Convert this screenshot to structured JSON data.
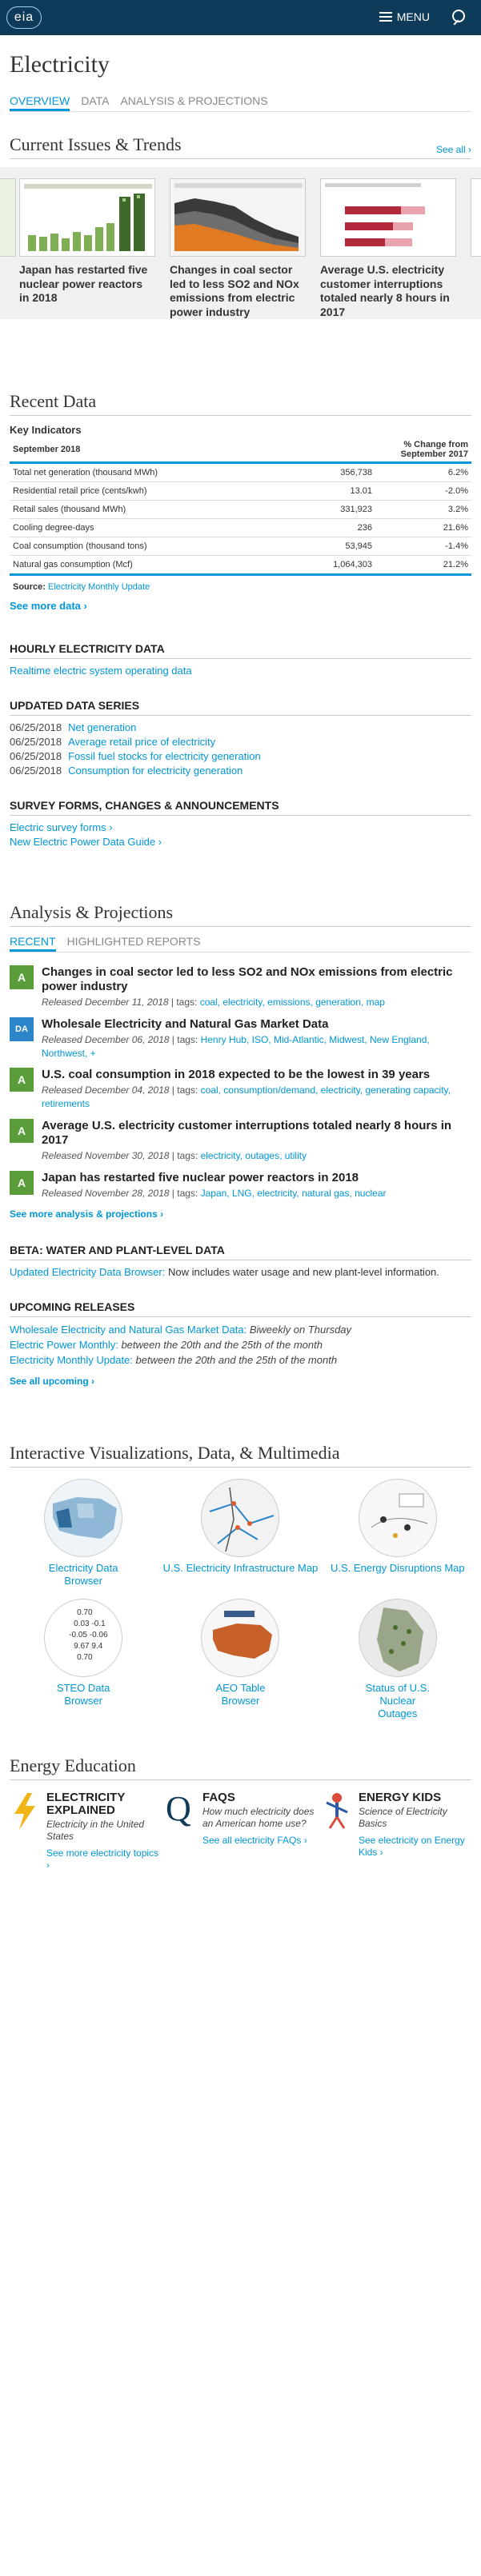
{
  "header": {
    "logo": "eia",
    "menu_label": "MENU"
  },
  "page_title": "Electricity",
  "tabs": [
    {
      "label": "OVERVIEW"
    },
    {
      "label": "DATA"
    },
    {
      "label": "ANALYSIS & PROJECTIONS"
    }
  ],
  "issues": {
    "title": "Current Issues & Trends",
    "see_all": "See all ›",
    "cards": [
      {
        "title": "Japan has restarted five nuclear power reactors in 2018"
      },
      {
        "title": "Changes in coal sector led to less SO2 and NOx emissions from electric power industry"
      },
      {
        "title": "Average U.S. electricity customer interruptions totaled nearly 8 hours in 2017"
      }
    ]
  },
  "recent_data": {
    "title": "Recent Data",
    "key_indicators": "Key Indicators",
    "col_period": "September 2018",
    "col_change": "% Change from September 2017",
    "rows": [
      {
        "label": "Total net generation (thousand MWh)",
        "value": "356,738",
        "change": "6.2%"
      },
      {
        "label": "Residential retail price (cents/kwh)",
        "value": "13.01",
        "change": "-2.0%"
      },
      {
        "label": "Retail sales (thousand MWh)",
        "value": "331,923",
        "change": "3.2%"
      },
      {
        "label": "Cooling degree-days",
        "value": "236",
        "change": "21.6%"
      },
      {
        "label": "Coal consumption (thousand tons)",
        "value": "53,945",
        "change": "-1.4%"
      },
      {
        "label": "Natural gas consumption (Mcf)",
        "value": "1,064,303",
        "change": "21.2%"
      }
    ],
    "source_label": "Source:",
    "source_link": "Electricity Monthly Update",
    "see_more": "See more data ›"
  },
  "hourly": {
    "title": "HOURLY ELECTRICITY DATA",
    "link": "Realtime electric system operating data"
  },
  "updated": {
    "title": "UPDATED DATA SERIES",
    "items": [
      {
        "date": "06/25/2018",
        "label": "Net generation"
      },
      {
        "date": "06/25/2018",
        "label": "Average retail price of electricity"
      },
      {
        "date": "06/25/2018",
        "label": "Fossil fuel stocks for electricity generation"
      },
      {
        "date": "06/25/2018",
        "label": "Consumption for electricity generation"
      }
    ]
  },
  "survey": {
    "title": "SURVEY FORMS, CHANGES & ANNOUNCEMENTS",
    "items": [
      {
        "label": "Electric survey forms ›"
      },
      {
        "label": "New Electric Power Data Guide ›"
      }
    ]
  },
  "analysis": {
    "title": "Analysis & Projections",
    "tabs": [
      {
        "label": "RECENT"
      },
      {
        "label": "HIGHLIGHTED REPORTS"
      }
    ],
    "articles": [
      {
        "badge": "A",
        "title": "Changes in coal sector led to less SO2 and NOx emissions from electric power industry",
        "released": "Released December 11, 2018",
        "tags_label": "| tags:",
        "tags": "coal, electricity, emissions, generation, map"
      },
      {
        "badge": "DA",
        "title": "Wholesale Electricity and Natural Gas Market Data",
        "released": "Released December 06, 2018",
        "tags_label": "| tags:",
        "tags": "Henry Hub, ISO, Mid-Atlantic, Midwest, New England, Northwest,  +"
      },
      {
        "badge": "A",
        "title": "U.S. coal consumption in 2018 expected to be the lowest in 39 years",
        "released": "Released December 04, 2018",
        "tags_label": "| tags:",
        "tags": "coal, consumption/demand, electricity, generating capacity, retirements"
      },
      {
        "badge": "A",
        "title": "Average U.S. electricity customer interruptions totaled nearly 8 hours in 2017",
        "released": "Released November 30, 2018",
        "tags_label": "| tags:",
        "tags": "electricity, outages, utility"
      },
      {
        "badge": "A",
        "title": "Japan has restarted five nuclear power reactors in 2018",
        "released": "Released November 28, 2018",
        "tags_label": "| tags:",
        "tags": "Japan, LNG, electricity, natural gas, nuclear"
      }
    ],
    "see_more": "See more analysis & projections ›"
  },
  "beta": {
    "title": "BETA: WATER AND PLANT-LEVEL DATA",
    "link": "Updated Electricity Data Browser:",
    "text": "Now includes water usage and new plant-level information."
  },
  "upcoming": {
    "title": "UPCOMING RELEASES",
    "items": [
      {
        "label": "Wholesale Electricity and Natural Gas Market Data:",
        "when": "Biweekly on Thursday"
      },
      {
        "label": "Electric Power Monthly:",
        "when": "between the 20th and the 25th of the month"
      },
      {
        "label": "Electricity Monthly Update:",
        "when": "between the 20th and the 25th of the month"
      }
    ],
    "see_all": "See all upcoming ›"
  },
  "viz": {
    "title": "Interactive Visualizations, Data, & Multimedia",
    "items": [
      {
        "label": "Electricity Data Browser"
      },
      {
        "label": "U.S. Electricity Infrastructure Map"
      },
      {
        "label": "U.S. Energy Disruptions Map"
      },
      {
        "label": "STEO Data Browser",
        "values": [
          "0.70",
          "0.03",
          "-0.1",
          "-0.05",
          "-0.06",
          "9.67",
          "9.4",
          "0.70"
        ]
      },
      {
        "label": "AEO Table Browser"
      },
      {
        "label": "Status of U.S. Nuclear Outages"
      }
    ]
  },
  "education": {
    "title": "Energy Education",
    "items": [
      {
        "title": "ELECTRICITY EXPLAINED",
        "desc": "Electricity in the United States",
        "link": "See more electricity topics ›"
      },
      {
        "title": "FAQS",
        "desc": "How much electricity does an American home use?",
        "link": "See all electricity FAQs ›"
      },
      {
        "title": "ENERGY KIDS",
        "desc": "Science of Electricity Basics",
        "link": "See electricity on Energy Kids ›"
      }
    ]
  },
  "colors": {
    "header": "#0f3b5a",
    "link": "#0096d7",
    "badge_green": "#5a9c3a",
    "badge_blue": "#2a86c8"
  }
}
